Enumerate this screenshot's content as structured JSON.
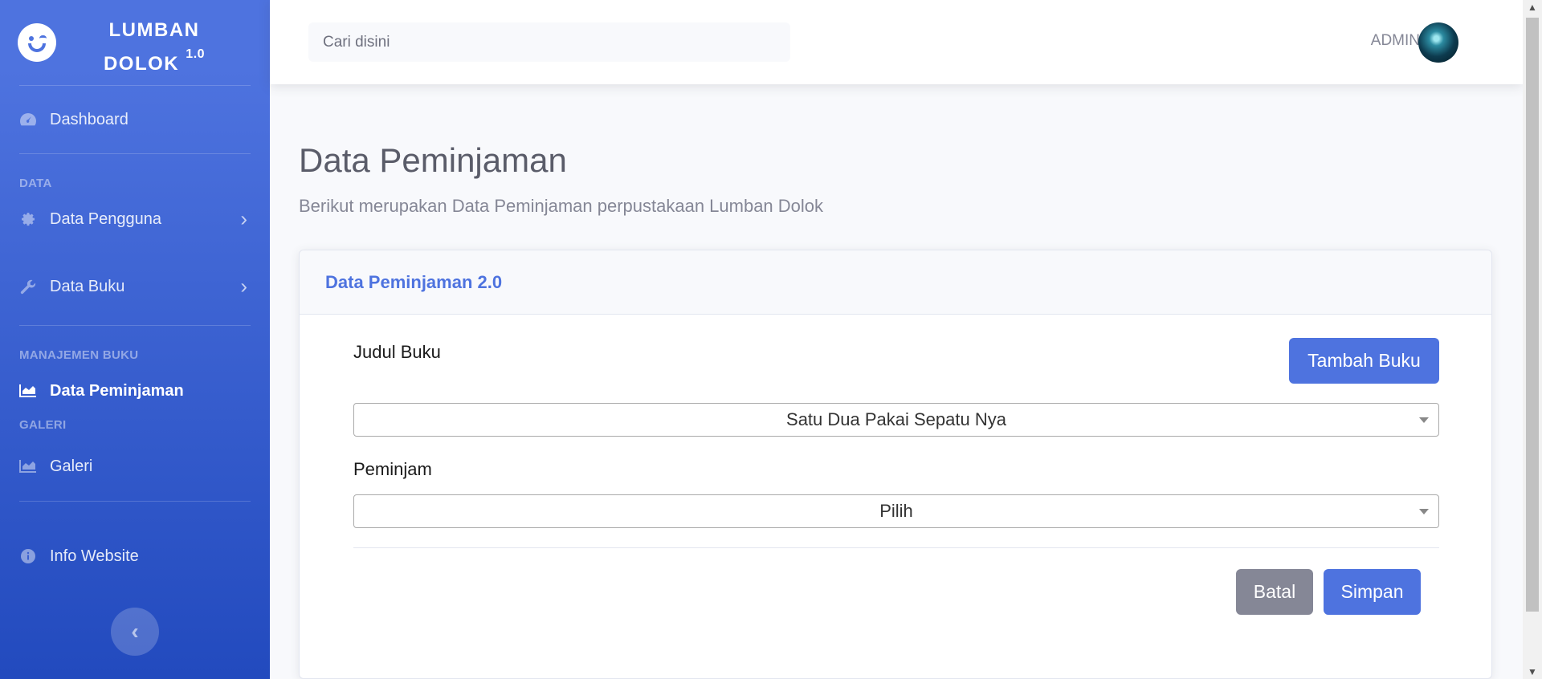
{
  "brand": {
    "line1": "LUMBAN",
    "line2": "DOLOK",
    "version": "1.0"
  },
  "sidebar": {
    "dashboard": "Dashboard",
    "heading_data": "DATA",
    "data_pengguna": "Data Pengguna",
    "data_buku": "Data Buku",
    "heading_manajemen": "MANAJEMEN BUKU",
    "data_peminjaman": "Data Peminjaman",
    "heading_galeri": "GALERI",
    "galeri": "Galeri",
    "info_website": "Info Website",
    "toggle_symbol": "‹"
  },
  "topbar": {
    "search_placeholder": "Cari disini",
    "user_name": "ADMIN"
  },
  "page": {
    "title": "Data Peminjaman",
    "subtitle": "Berikut merupakan Data Peminjaman perpustakaan Lumban Dolok"
  },
  "card": {
    "header": "Data Peminjaman 2.0",
    "judul_label": "Judul Buku",
    "tambah_button": "Tambah Buku",
    "judul_value": "Satu Dua Pakai Sepatu Nya",
    "peminjam_label": "Peminjam",
    "peminjam_value": "Pilih",
    "batal_button": "Batal",
    "simpan_button": "Simpan"
  },
  "colors": {
    "primary": "#4e73df",
    "primary_dark": "#224abe",
    "secondary": "#858796",
    "background": "#f8f9fc"
  }
}
